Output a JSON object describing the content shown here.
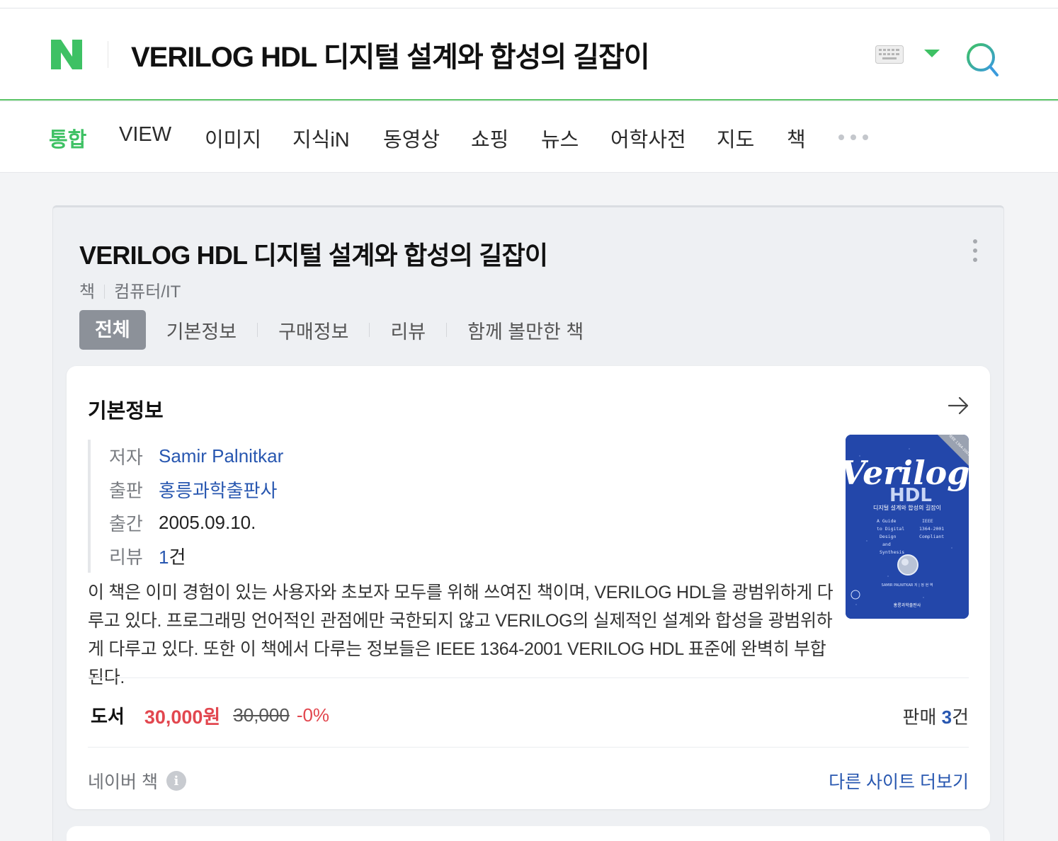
{
  "header": {
    "query": "VERILOG HDL 디지털 설계와 합성의 길잡이",
    "logo": "N",
    "brand_color": "#3ec164"
  },
  "tabs": [
    "통합",
    "VIEW",
    "이미지",
    "지식iN",
    "동영상",
    "쇼핑",
    "뉴스",
    "어학사전",
    "지도",
    "책"
  ],
  "book": {
    "title": "VERILOG HDL 디지털 설계와 합성의 길잡이",
    "category_type": "책",
    "category": "컴퓨터/IT",
    "subtabs": [
      "전체",
      "기본정보",
      "구매정보",
      "리뷰",
      "함께 볼만한 책"
    ]
  },
  "basic_info": {
    "heading": "기본정보",
    "rows": [
      {
        "key": "저자",
        "value": "Samir Palnitkar"
      },
      {
        "key": "출판",
        "value": "홍릉과학출판사"
      },
      {
        "key": "출간",
        "value": "2005.09.10."
      },
      {
        "key": "리뷰",
        "value_num": "1",
        "value_suffix": "건"
      }
    ],
    "description": "이 책은 이미 경험이 있는 사용자와 초보자 모두를 위해 쓰여진 책이며, VERILOG HDL을 광범위하게 다루고 있다. 프로그래밍 언어적인 관점에만 국한되지 않고 VERILOG의 실제적인 설계와 합성을 광범위하게 다루고 있다. 또한 이 책에서 다루는 정보들은 IEEE 1364-2001 VERILOG HDL 표준에 완벽히 부합된다."
  },
  "cover": {
    "line1": "Verilog",
    "line2": "HDL",
    "subtitle": "디지털 설계와 합성의 길잡이",
    "left_text": [
      "A Guide",
      "to Digital",
      "Design",
      "and",
      "Synthesis"
    ],
    "right_text": [
      "IEEE",
      "1364-2001",
      "Compliant"
    ],
    "authors": "SAMIR PALNITKAR 저 | 정 현 역",
    "publisher": "홍릉과학출판사",
    "badge": "IEEE 1364-2001"
  },
  "price": {
    "label": "도서",
    "price": "30,000원",
    "original": "30,000",
    "discount": "-0%",
    "sales_label": "판매",
    "sales_num": "3",
    "sales_suffix": "건"
  },
  "footer": {
    "source": "네이버 책",
    "info_icon": "i",
    "more_link": "다른 사이트 더보기"
  }
}
